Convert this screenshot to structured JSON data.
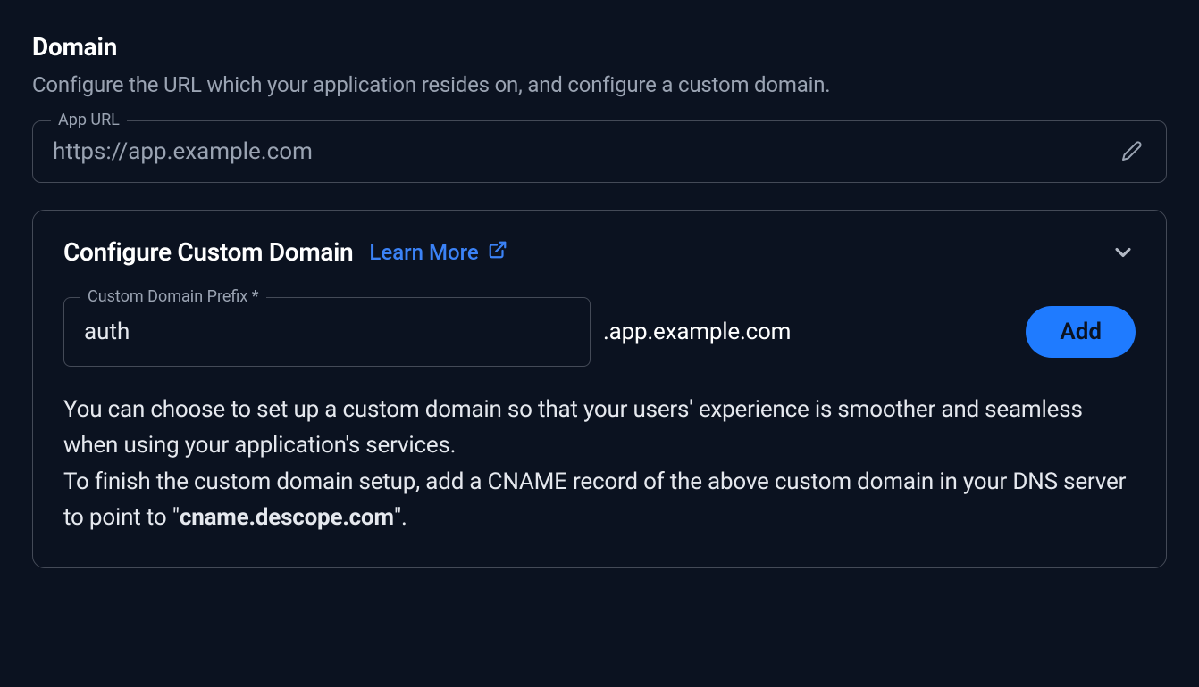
{
  "section": {
    "title": "Domain",
    "description": "Configure the URL which your application resides on, and configure a custom domain."
  },
  "app_url_field": {
    "label": "App URL",
    "placeholder": "https://app.example.com",
    "value": ""
  },
  "custom_domain": {
    "title": "Configure Custom Domain",
    "learn_more_label": "Learn More",
    "prefix_field": {
      "label": "Custom Domain Prefix *",
      "value": "auth"
    },
    "suffix": ".app.example.com",
    "add_button_label": "Add",
    "help_line1": "You can choose to set up a custom domain so that your users' experience is smoother and seamless when using your application's services.",
    "help_line2_before": "To finish the custom domain setup, add a CNAME record of the above custom domain in your DNS server to point to \"",
    "help_cname": "cname.descope.com",
    "help_line2_after": "\"."
  },
  "icons": {
    "edit": "pencil-icon",
    "external": "external-link-icon",
    "chevron": "chevron-down-icon"
  },
  "colors": {
    "accent": "#1f7bff",
    "link": "#3b82f6",
    "bg": "#0b1220",
    "border": "#444a57",
    "muted": "#9aa3b2"
  }
}
